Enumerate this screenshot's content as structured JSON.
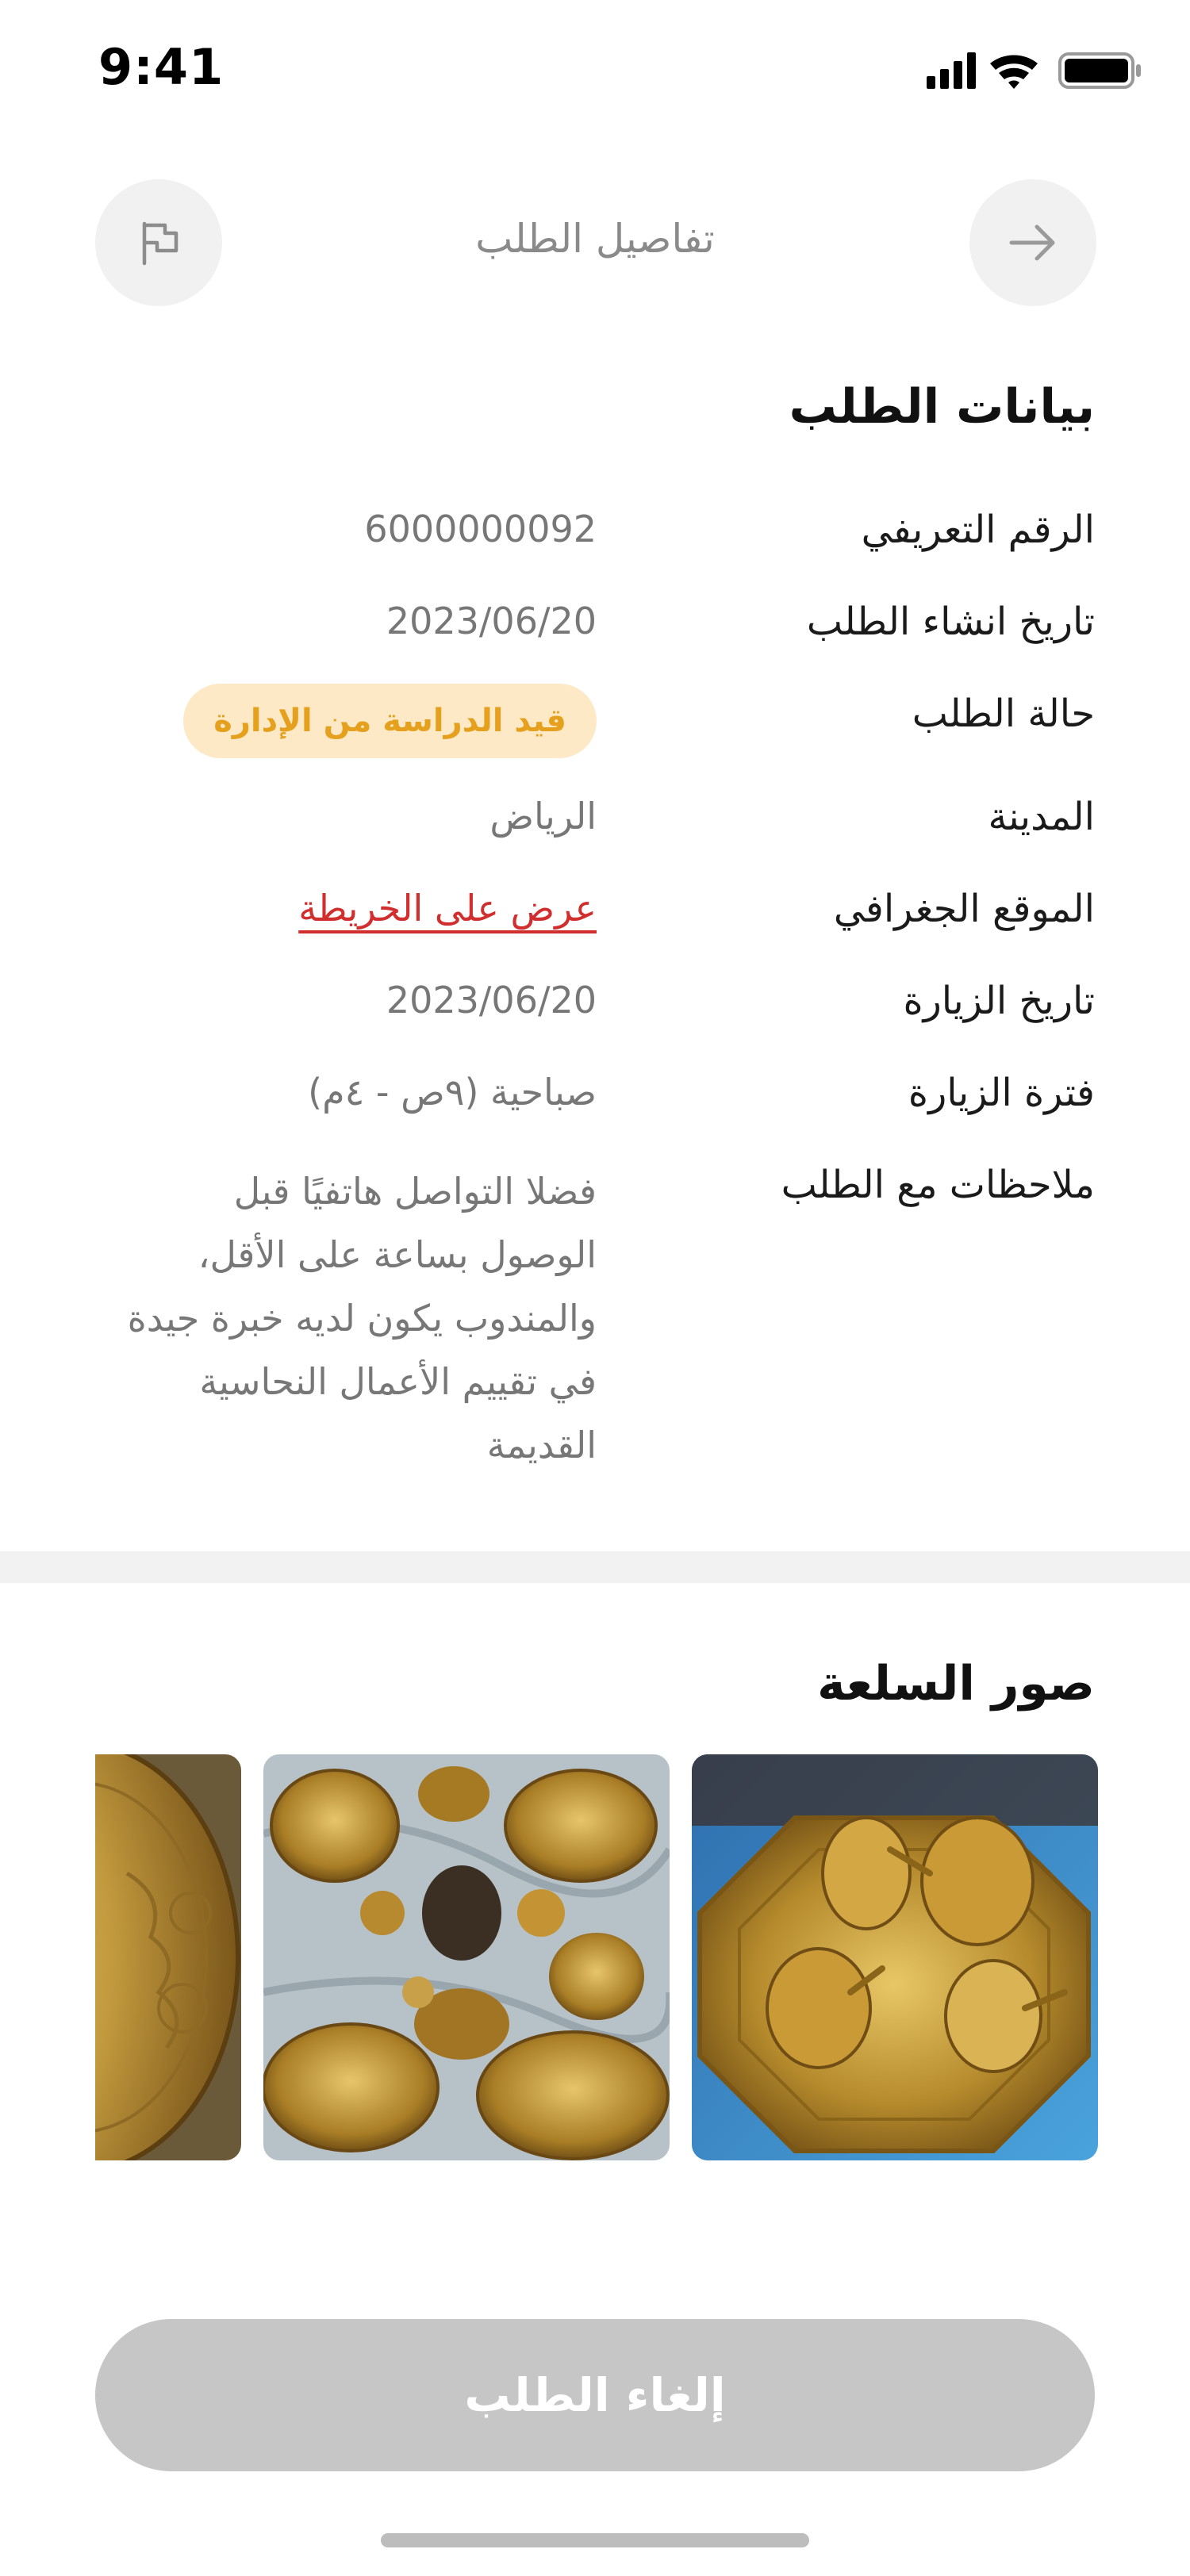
{
  "status_bar": {
    "time": "9:41"
  },
  "header": {
    "title": "تفاصيل الطلب",
    "back_icon": "arrow-right-icon",
    "report_icon": "flag-icon"
  },
  "order_details": {
    "section_title": "بيانات الطلب",
    "rows": {
      "id": {
        "label": "الرقم التعريفي",
        "value": "6000000092"
      },
      "created": {
        "label": "تاريخ انشاء الطلب",
        "value": "2023/06/20"
      },
      "status": {
        "label": "حالة الطلب",
        "value": "قيد الدراسة من الإدارة"
      },
      "city": {
        "label": "المدينة",
        "value": "الرياض"
      },
      "location": {
        "label": "الموقع الجغرافي",
        "value": "عرض على الخريطة"
      },
      "visit_date": {
        "label": "تاريخ الزيارة",
        "value": "2023/06/20"
      },
      "visit_period": {
        "label": "فترة الزيارة",
        "value": "صباحية (٩ص - ٤م)"
      },
      "notes": {
        "label": "ملاحظات مع الطلب",
        "value": "فضلا التواصل هاتفيًا قبل الوصول بساعة على الأقل، والمندوب يكون لديه خبرة جيدة في تقييم الأعمال النحاسية القديمة"
      }
    }
  },
  "gallery": {
    "section_title": "صور السلعة"
  },
  "actions": {
    "cancel_label": "إلغاء الطلب"
  },
  "colors": {
    "accent_red": "#d12e2e",
    "badge_bg": "#fde9c6",
    "badge_text": "#e5a01e",
    "button_disabled": "#c6c6c6"
  }
}
